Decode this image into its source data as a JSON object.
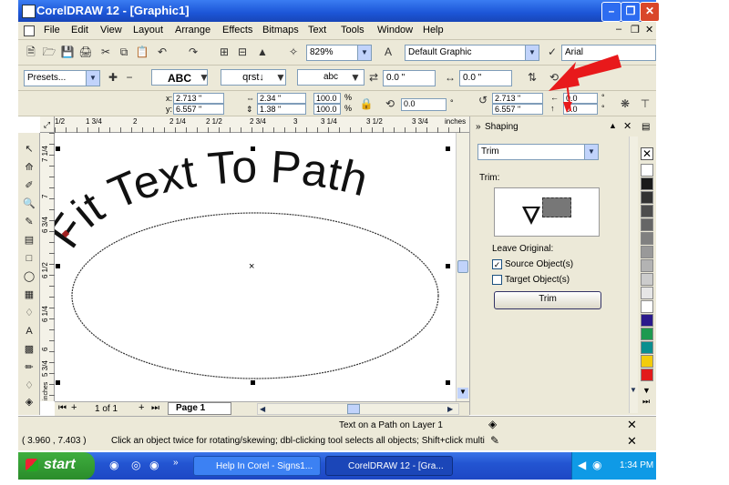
{
  "window": {
    "title": "CorelDRAW 12 - [Graphic1]"
  },
  "menu": [
    "File",
    "Edit",
    "View",
    "Layout",
    "Arrange",
    "Effects",
    "Bitmaps",
    "Text",
    "Tools",
    "Window",
    "Help"
  ],
  "standard": {
    "zoom": "829%",
    "style_preset": "Default Graphic",
    "font": "Arial",
    "rot1": "0.0 \"",
    "rot2": "0.0 \""
  },
  "property": {
    "presets": "Presets...",
    "x": "2.713 \"",
    "y": "6.557 \"",
    "w": "2.34 \"",
    "h": "1.38 \"",
    "scale_w": "100.0",
    "scale_h": "100.0",
    "percent": "%",
    "angle": "0.0",
    "deg": "°",
    "x2": "2.713 \"",
    "y2": "6.557 \"",
    "spin1": "0.0",
    "spin2": "0.0"
  },
  "ruler": {
    "h": [
      "1/2",
      "1 3/4",
      "2",
      "2 1/4",
      "2 1/2",
      "2 3/4",
      "3",
      "3 1/4",
      "3 1/2",
      "3 3/4",
      "inches"
    ],
    "v": [
      "7 1/4",
      "7",
      "6 3/4",
      "6 1/2",
      "6 1/4",
      "6",
      "5 3/4"
    ],
    "v_unit": "inches"
  },
  "canvas": {
    "path_text": "Fit Text To Path"
  },
  "pagenav": {
    "count": "1 of 1",
    "tab": "Page 1"
  },
  "docker": {
    "title": "Shaping",
    "mode": "Trim",
    "section": "Trim:",
    "leave_original": "Leave Original:",
    "source_label": "Source Object(s)",
    "source_checked": true,
    "target_label": "Target Object(s)",
    "target_checked": false,
    "button": "Trim"
  },
  "palette": [
    "#ffffff",
    "#1a1a1a",
    "#333333",
    "#4d4d4d",
    "#666666",
    "#808080",
    "#999999",
    "#b3b3b3",
    "#cccccc",
    "#e6e6e6",
    "#ffffff",
    "#2a1a8c",
    "#1e9a50",
    "#0b8f8f",
    "#f2cc0c",
    "#e21b1b"
  ],
  "status": {
    "object_info": "Text on a Path on Layer 1",
    "coords": "( 3.960 , 7.403 )",
    "hint": "Click an object twice for rotating/skewing; dbl-clicking tool selects all objects; Shift+click multi-se..."
  },
  "taskbar": {
    "start": "start",
    "items": [
      "Help In Corel - Signs1...",
      "CorelDRAW 12 - [Gra..."
    ],
    "clock": "1:34 PM"
  },
  "accent": {
    "arrow": "#e8191b",
    "titlebar": "#1c55d6"
  }
}
